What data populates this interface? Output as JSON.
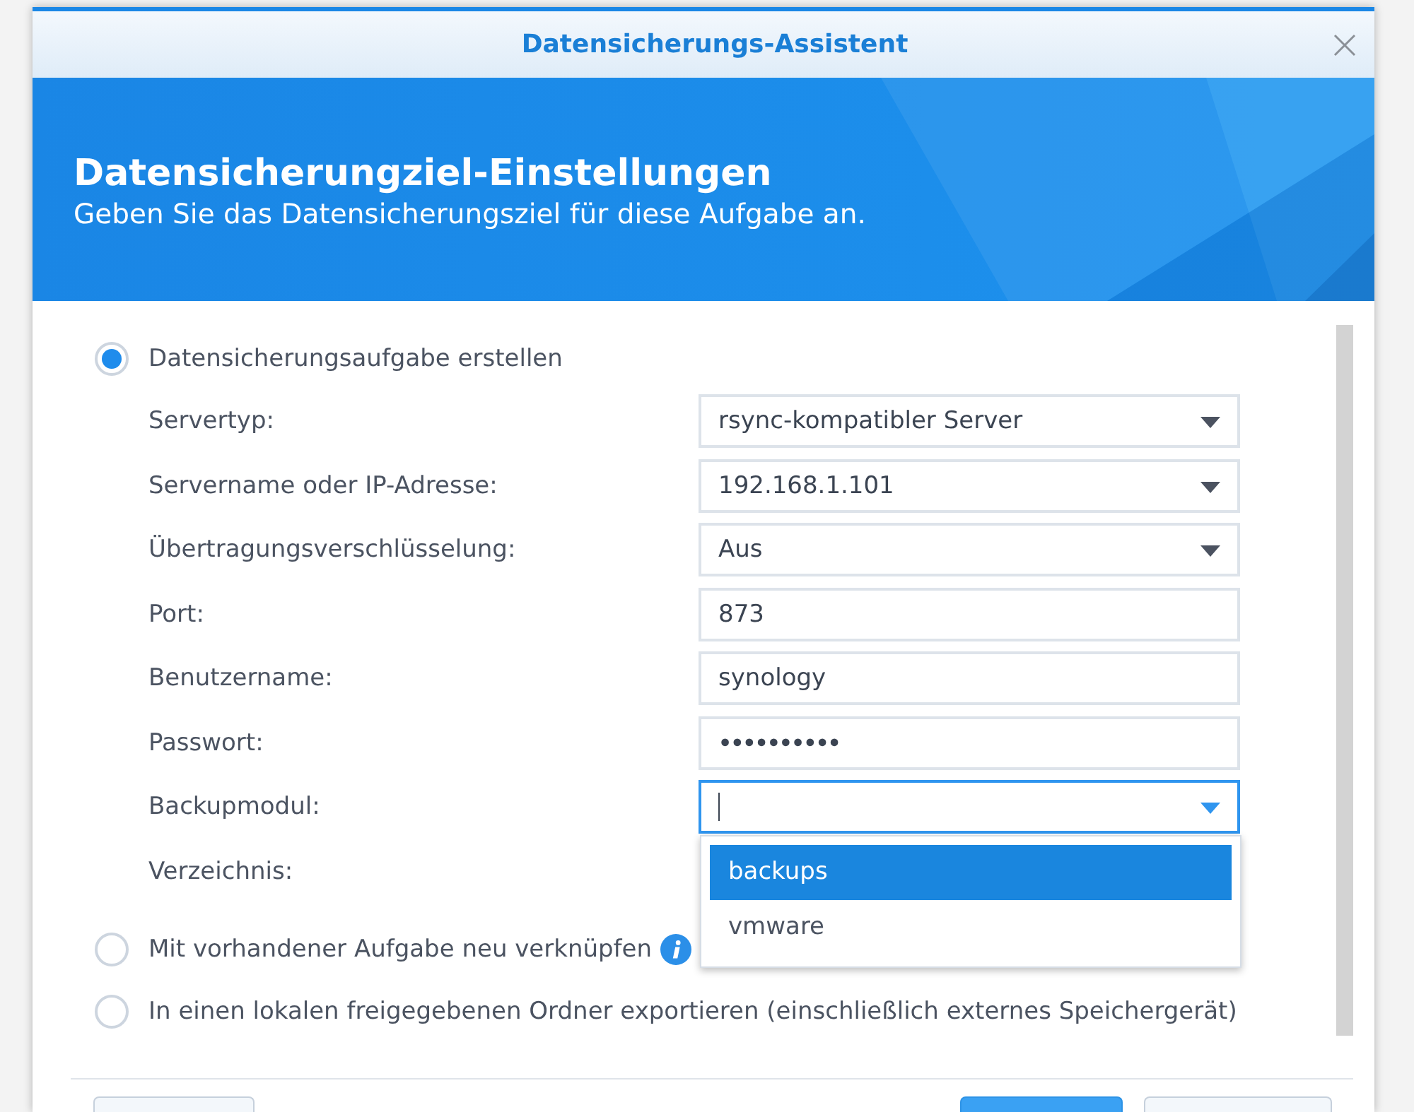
{
  "window": {
    "title": "Datensicherungs-Assistent"
  },
  "header": {
    "title": "Datensicherungziel-Einstellungen",
    "subtitle": "Geben Sie das Datensicherungsziel für diese Aufgabe an."
  },
  "options": [
    {
      "label": "Datensicherungsaufgabe erstellen",
      "selected": true,
      "info": false,
      "fields": [
        {
          "label": "Servertyp:",
          "kind": "select",
          "value": "rsync-kompatibler Server",
          "focused": false
        },
        {
          "label": "Servername oder IP-Adresse:",
          "kind": "select",
          "value": "192.168.1.101",
          "focused": false
        },
        {
          "label": "Übertragungsverschlüsselung:",
          "kind": "select",
          "value": "Aus",
          "focused": false
        },
        {
          "label": "Port:",
          "kind": "text",
          "value": "873",
          "focused": false
        },
        {
          "label": "Benutzername:",
          "kind": "text",
          "value": "synology",
          "focused": false
        },
        {
          "label": "Passwort:",
          "kind": "password",
          "value": "••••••••••",
          "focused": false
        },
        {
          "label": "Backupmodul:",
          "kind": "select",
          "focused": true,
          "open": true,
          "menu": [
            {
              "label": "backups",
              "selected": true
            },
            {
              "label": "vmware",
              "selected": false
            }
          ]
        },
        {
          "label": "Verzeichnis:"
        }
      ]
    },
    {
      "label": "Mit vorhandener Aufgabe neu verknüpfen",
      "selected": false,
      "info": true
    },
    {
      "label": "In einen lokalen freigegebenen Ordner exportieren (einschließlich externes Speichergerät)",
      "selected": false,
      "info": false
    }
  ],
  "footer": {
    "buttons": [
      {
        "kind": "secondary"
      },
      {
        "kind": "primary"
      },
      {
        "kind": "secondary"
      }
    ]
  }
}
